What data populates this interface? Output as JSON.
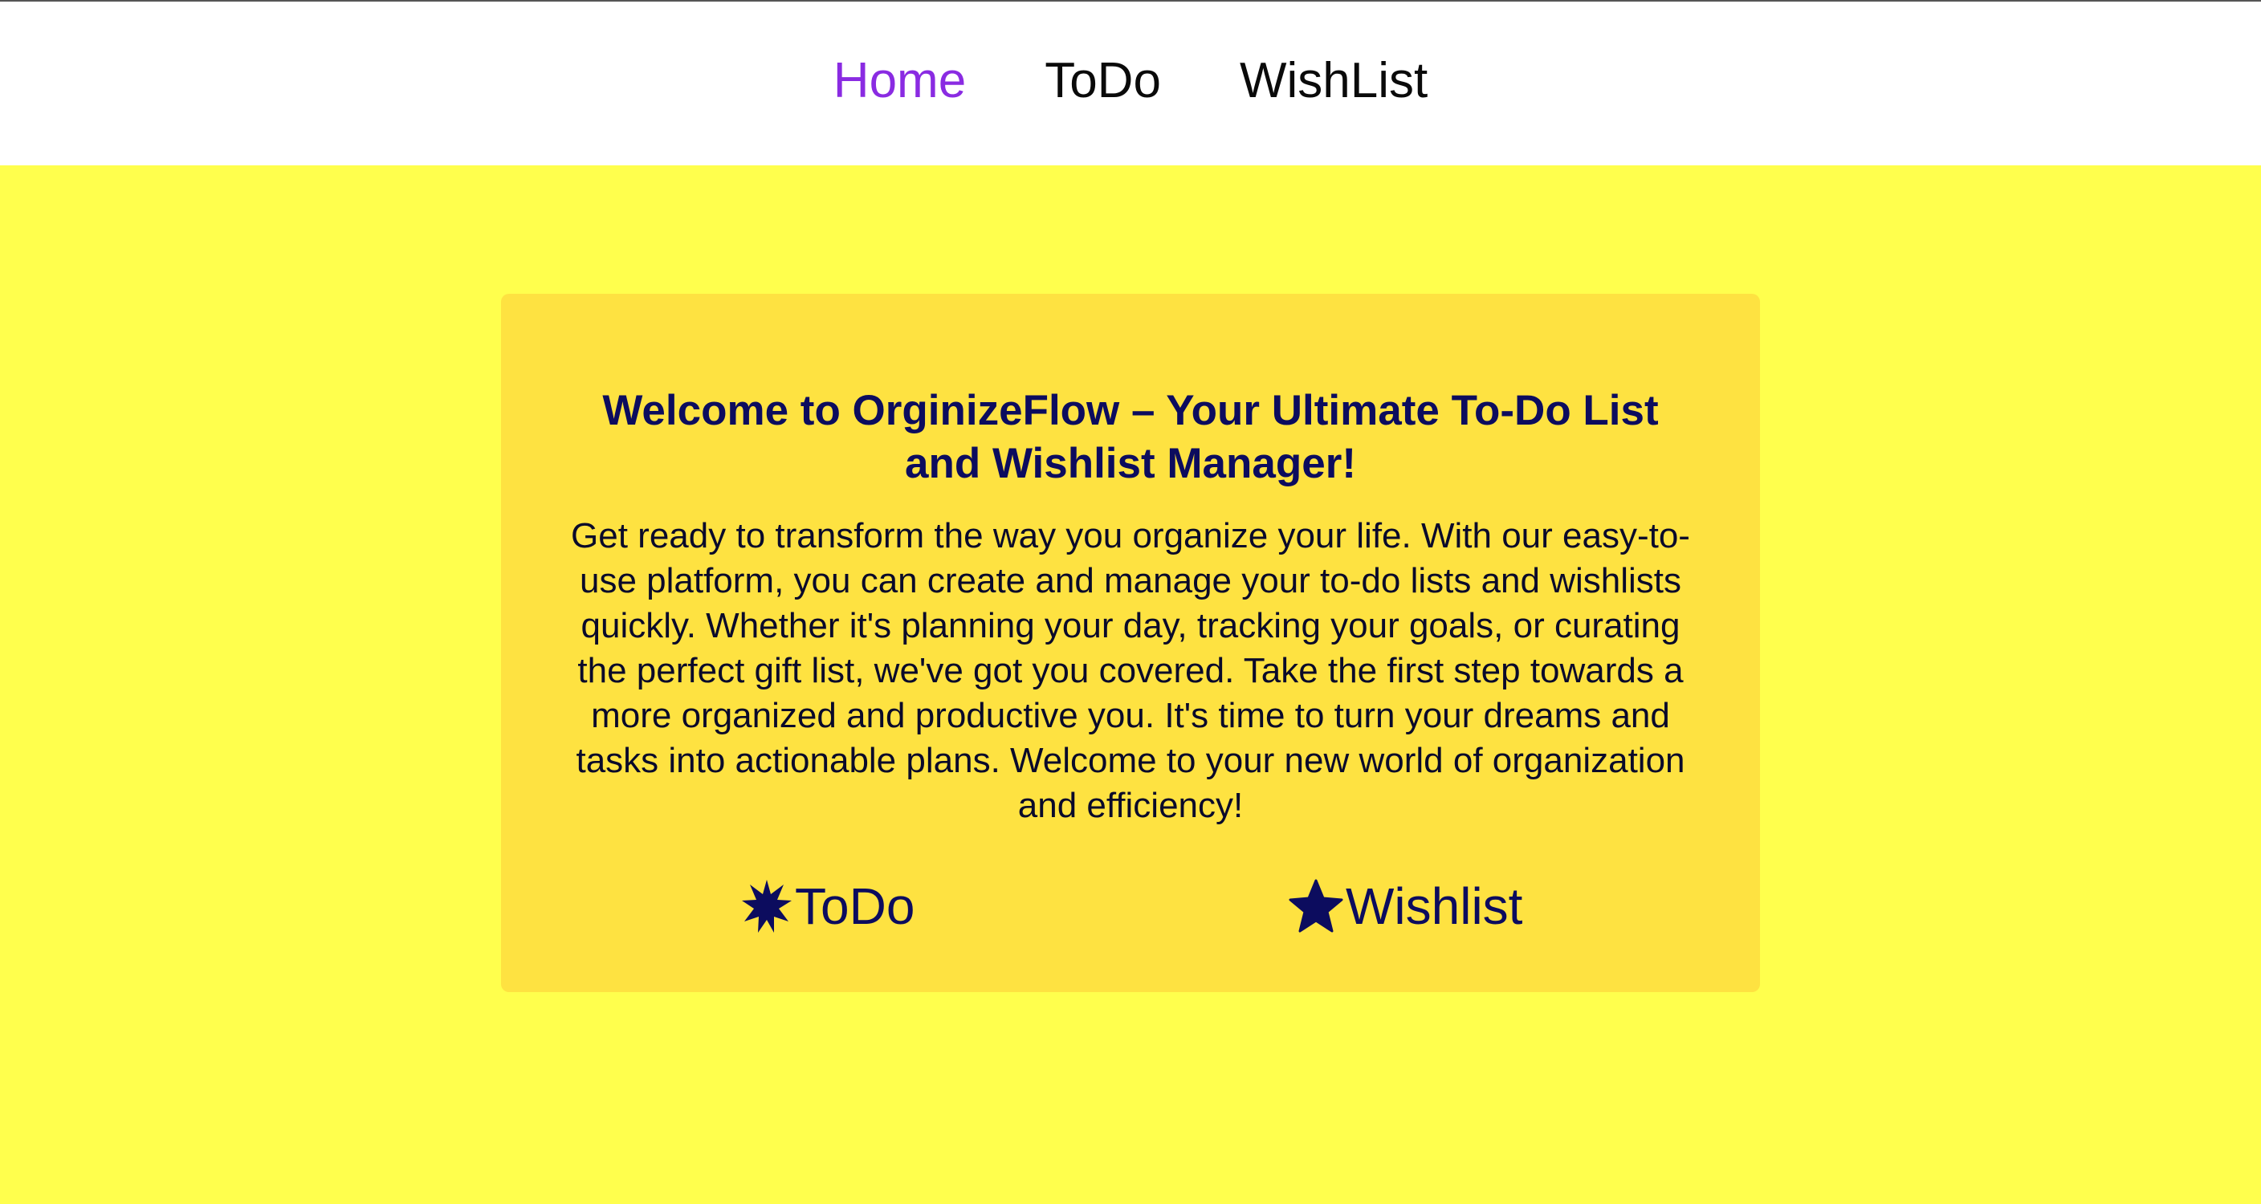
{
  "nav": {
    "items": [
      {
        "label": "Home",
        "active": true
      },
      {
        "label": "ToDo",
        "active": false
      },
      {
        "label": "WishList",
        "active": false
      }
    ]
  },
  "hero": {
    "title": "Welcome to OrginizeFlow – Your Ultimate To-Do List and Wishlist Manager!",
    "body": "Get ready to transform the way you organize your life. With our easy-to-use platform, you can create and manage your to-do lists and wishlists quickly. Whether it's planning your day, tracking your goals, or curating the perfect gift list, we've got you covered. Take the first step towards a more organized and productive you. It's time to turn your dreams and tasks into actionable plans. Welcome to your new world of organization and efficiency!",
    "links": [
      {
        "label": "ToDo",
        "icon": "burst-star-icon"
      },
      {
        "label": "Wishlist",
        "icon": "star-icon"
      }
    ]
  },
  "colors": {
    "accent": "#8a2be2",
    "page_background": "#ffff4d",
    "card_background": "#fee241",
    "heading": "#0c0c5e"
  }
}
